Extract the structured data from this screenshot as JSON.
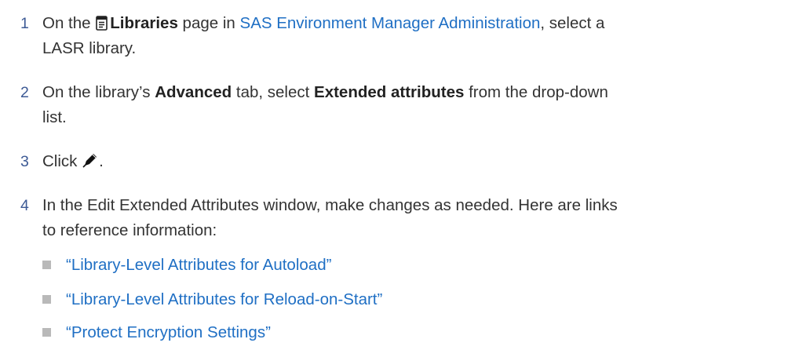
{
  "steps": [
    {
      "number": "1",
      "pre": "On the ",
      "icon": "libraries-icon",
      "bold": "Libraries",
      "mid": " page in ",
      "link": "SAS Environment Manager Administration",
      "post_line1": ", select a",
      "line2": "LASR library."
    },
    {
      "number": "2",
      "pre": "On the library’s ",
      "bold1": "Advanced",
      "mid": " tab, select ",
      "bold2": "Extended attributes",
      "post_line1": " from the drop-down",
      "line2": "list."
    },
    {
      "number": "3",
      "pre": "Click ",
      "icon": "edit-pencil-icon",
      "post": "."
    },
    {
      "number": "4",
      "line1": "In the Edit Extended Attributes window, make changes as needed. Here are links",
      "line2": "to reference information:",
      "links": [
        "“Library-Level Attributes for Autoload”",
        "“Library-Level Attributes for Reload-on-Start”",
        "“Protect Encryption Settings”"
      ]
    }
  ],
  "colors": {
    "step_number": "#3d5a95",
    "link": "#1f6fc4",
    "text": "#333333",
    "bullet": "#b9b9b9"
  }
}
